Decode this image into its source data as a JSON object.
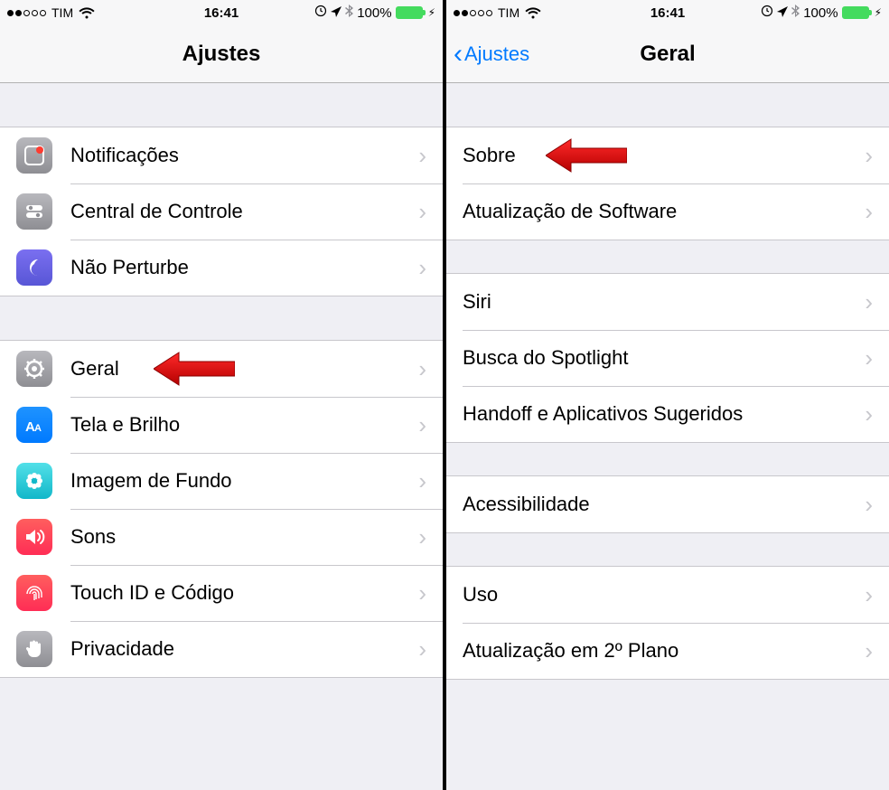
{
  "status": {
    "carrier": "TIM",
    "time": "16:41",
    "battery_pct": "100%",
    "wifi": true
  },
  "left": {
    "title": "Ajustes",
    "groups": [
      {
        "rows": [
          {
            "label": "Notificações",
            "icon": "notifications"
          },
          {
            "label": "Central de Controle",
            "icon": "control-center"
          },
          {
            "label": "Não Perturbe",
            "icon": "dnd"
          }
        ]
      },
      {
        "rows": [
          {
            "label": "Geral",
            "icon": "general"
          },
          {
            "label": "Tela e Brilho",
            "icon": "display"
          },
          {
            "label": "Imagem de Fundo",
            "icon": "wallpaper"
          },
          {
            "label": "Sons",
            "icon": "sounds"
          },
          {
            "label": "Touch ID e Código",
            "icon": "touchid"
          },
          {
            "label": "Privacidade",
            "icon": "privacy"
          }
        ]
      }
    ]
  },
  "right": {
    "back_label": "Ajustes",
    "title": "Geral",
    "groups": [
      {
        "rows": [
          {
            "label": "Sobre"
          },
          {
            "label": "Atualização de Software"
          }
        ]
      },
      {
        "rows": [
          {
            "label": "Siri"
          },
          {
            "label": "Busca do Spotlight"
          },
          {
            "label": "Handoff e Aplicativos Sugeridos"
          }
        ]
      },
      {
        "rows": [
          {
            "label": "Acessibilidade"
          }
        ]
      },
      {
        "rows": [
          {
            "label": "Uso"
          },
          {
            "label": "Atualização em 2º Plano"
          }
        ]
      }
    ]
  },
  "annotations": {
    "arrow_color": "#d50000"
  }
}
